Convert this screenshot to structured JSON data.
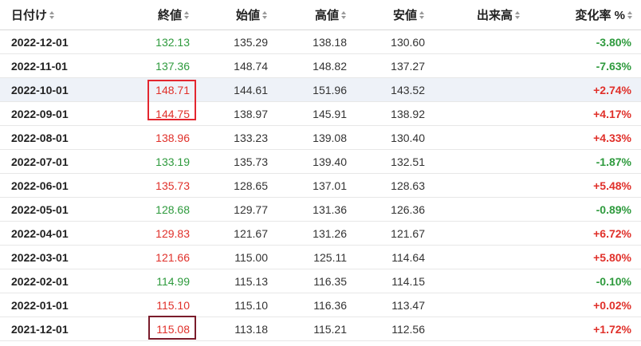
{
  "columns": [
    {
      "key": "date",
      "label": "日付け"
    },
    {
      "key": "close",
      "label": "終値"
    },
    {
      "key": "open",
      "label": "始値"
    },
    {
      "key": "high",
      "label": "高値"
    },
    {
      "key": "low",
      "label": "安値"
    },
    {
      "key": "volume",
      "label": "出来高"
    },
    {
      "key": "change",
      "label": "変化率 %"
    }
  ],
  "rows": [
    {
      "date": "2022-12-01",
      "close": "132.13",
      "open": "135.29",
      "high": "138.18",
      "low": "130.60",
      "volume": "",
      "change": "-3.80%",
      "dir": "down"
    },
    {
      "date": "2022-11-01",
      "close": "137.36",
      "open": "148.74",
      "high": "148.82",
      "low": "137.27",
      "volume": "",
      "change": "-7.63%",
      "dir": "down"
    },
    {
      "date": "2022-10-01",
      "close": "148.71",
      "open": "144.61",
      "high": "151.96",
      "low": "143.52",
      "volume": "",
      "change": "+2.74%",
      "dir": "up"
    },
    {
      "date": "2022-09-01",
      "close": "144.75",
      "open": "138.97",
      "high": "145.91",
      "low": "138.92",
      "volume": "",
      "change": "+4.17%",
      "dir": "up"
    },
    {
      "date": "2022-08-01",
      "close": "138.96",
      "open": "133.23",
      "high": "139.08",
      "low": "130.40",
      "volume": "",
      "change": "+4.33%",
      "dir": "up"
    },
    {
      "date": "2022-07-01",
      "close": "133.19",
      "open": "135.73",
      "high": "139.40",
      "low": "132.51",
      "volume": "",
      "change": "-1.87%",
      "dir": "down"
    },
    {
      "date": "2022-06-01",
      "close": "135.73",
      "open": "128.65",
      "high": "137.01",
      "low": "128.63",
      "volume": "",
      "change": "+5.48%",
      "dir": "up"
    },
    {
      "date": "2022-05-01",
      "close": "128.68",
      "open": "129.77",
      "high": "131.36",
      "low": "126.36",
      "volume": "",
      "change": "-0.89%",
      "dir": "down"
    },
    {
      "date": "2022-04-01",
      "close": "129.83",
      "open": "121.67",
      "high": "131.26",
      "low": "121.67",
      "volume": "",
      "change": "+6.72%",
      "dir": "up"
    },
    {
      "date": "2022-03-01",
      "close": "121.66",
      "open": "115.00",
      "high": "125.11",
      "low": "114.64",
      "volume": "",
      "change": "+5.80%",
      "dir": "up"
    },
    {
      "date": "2022-02-01",
      "close": "114.99",
      "open": "115.13",
      "high": "116.35",
      "low": "114.15",
      "volume": "",
      "change": "-0.10%",
      "dir": "down"
    },
    {
      "date": "2022-01-01",
      "close": "115.10",
      "open": "115.10",
      "high": "116.36",
      "low": "113.47",
      "volume": "",
      "change": "+0.02%",
      "dir": "up"
    },
    {
      "date": "2021-12-01",
      "close": "115.08",
      "open": "113.18",
      "high": "115.21",
      "low": "112.56",
      "volume": "",
      "change": "+1.72%",
      "dir": "up"
    }
  ],
  "colors": {
    "up": "#e0302a",
    "down": "#2e9a3d",
    "highlight_red": "#e3262f",
    "highlight_dark": "#7a1c2b",
    "selected_row_bg": "#eef2f8"
  },
  "icons": {
    "sort": "sort-updown-icon"
  }
}
